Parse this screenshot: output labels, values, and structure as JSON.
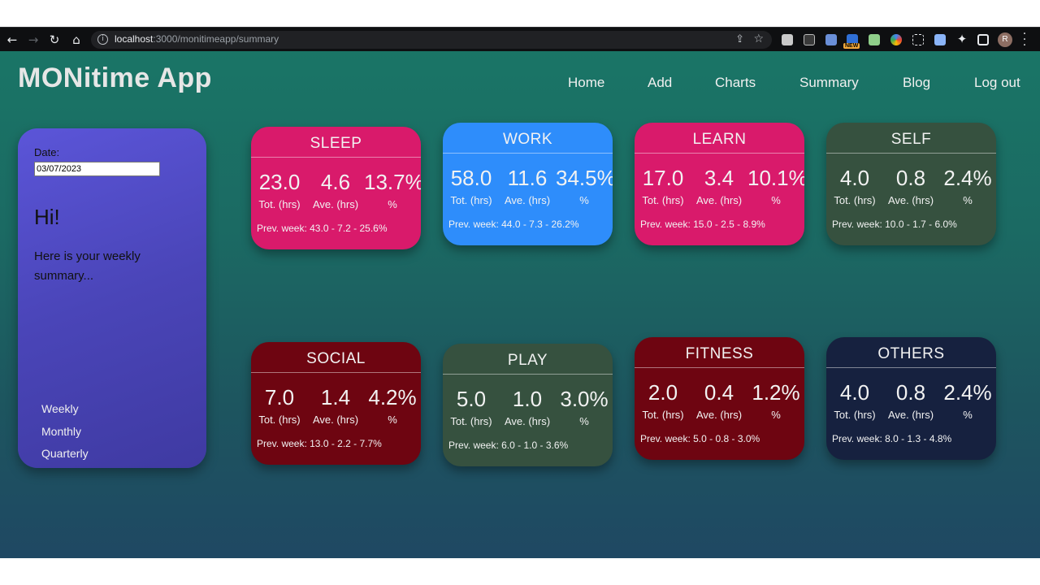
{
  "browser": {
    "url_host": "localhost",
    "url_path": ":3000/monitimeapp/summary",
    "avatar_letter": "R",
    "extension_badge": "NEW"
  },
  "app": {
    "brand": "MONitime App",
    "nav": [
      "Home",
      "Add",
      "Charts",
      "Summary",
      "Blog",
      "Log out"
    ]
  },
  "panel": {
    "date_label": "Date:",
    "date_value": "03/07/2023",
    "greeting": "Hi!",
    "message": "Here is your weekly summary...",
    "periods": [
      "Weekly",
      "Monthly",
      "Quarterly"
    ]
  },
  "labels": {
    "tot": "Tot. (hrs)",
    "ave": "Ave. (hrs)",
    "pct": "%"
  },
  "cards": [
    {
      "title": "SLEEP",
      "total": "23.0",
      "ave": "4.6",
      "pct": "13.7%",
      "prev": "Prev. week: 43.0 - 7.2 - 25.6%",
      "color": "#d91a6b"
    },
    {
      "title": "WORK",
      "total": "58.0",
      "ave": "11.6",
      "pct": "34.5%",
      "prev": "Prev. week: 44.0 - 7.3 - 26.2%",
      "color": "#2e8dfb"
    },
    {
      "title": "LEARN",
      "total": "17.0",
      "ave": "3.4",
      "pct": "10.1%",
      "prev": "Prev. week: 15.0 - 2.5 - 8.9%",
      "color": "#d91a6b"
    },
    {
      "title": "SELF",
      "total": "4.0",
      "ave": "0.8",
      "pct": "2.4%",
      "prev": "Prev. week: 10.0 - 1.7 - 6.0%",
      "color": "#36513f"
    },
    {
      "title": "SOCIAL",
      "total": "7.0",
      "ave": "1.4",
      "pct": "4.2%",
      "prev": "Prev. week: 13.0 - 2.2 - 7.7%",
      "color": "#6e0511"
    },
    {
      "title": "PLAY",
      "total": "5.0",
      "ave": "1.0",
      "pct": "3.0%",
      "prev": "Prev. week: 6.0 - 1.0 - 3.6%",
      "color": "#36513f"
    },
    {
      "title": "FITNESS",
      "total": "2.0",
      "ave": "0.4",
      "pct": "1.2%",
      "prev": "Prev. week: 5.0 - 0.8 - 3.0%",
      "color": "#6e0511"
    },
    {
      "title": "OTHERS",
      "total": "4.0",
      "ave": "0.8",
      "pct": "2.4%",
      "prev": "Prev. week: 8.0 - 1.3 - 4.8%",
      "color": "#16213f"
    }
  ]
}
